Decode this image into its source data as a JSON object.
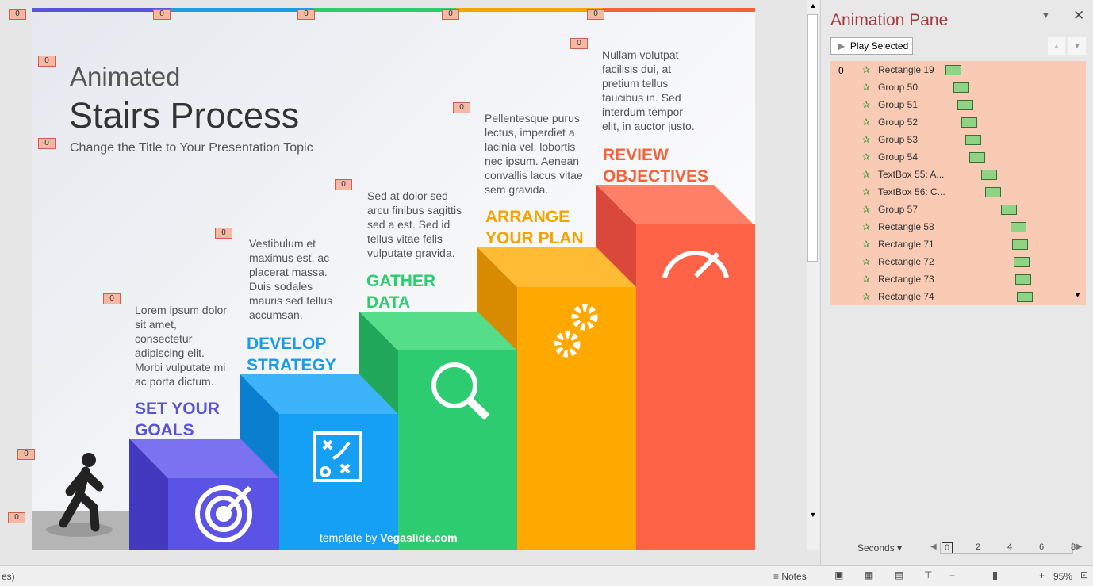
{
  "slide": {
    "title_line1": "Animated",
    "title_line2": "Stairs Process",
    "subtitle": "Change the Title to Your Presentation Topic",
    "steps": [
      {
        "heading1": "SET YOUR",
        "heading2": "GOALS",
        "text": [
          "Lorem ipsum dolor",
          "sit amet,",
          "consectetur",
          "adipiscing elit.",
          "Morbi vulputate mi",
          "ac porta dictum."
        ],
        "color": "#5a52d8",
        "icon": "target-icon"
      },
      {
        "heading1": "DEVELOP",
        "heading2": "STRATEGY",
        "text": [
          "Vestibulum et",
          "maximus est, ac",
          "placerat massa.",
          "Duis sodales",
          "mauris sed tellus",
          "accumsan."
        ],
        "color": "#1a9de6",
        "icon": "strategy-board-icon"
      },
      {
        "heading1": "GATHER",
        "heading2": "DATA",
        "text": [
          "Sed at dolor sed",
          "arcu finibus sagittis",
          "sed a est. Sed id",
          "tellus vitae felis",
          "vulputate gravida."
        ],
        "color": "#2ecc71",
        "icon": "magnifier-icon"
      },
      {
        "heading1": "ARRANGE",
        "heading2": "YOUR PLAN",
        "text": [
          "Pellentesque purus",
          "lectus, imperdiet a",
          "lacinia vel, lobortis",
          "nec ipsum. Aenean",
          "convallis lacus vitae",
          "sem gravida."
        ],
        "color": "#f5a300",
        "icon": "gears-icon"
      },
      {
        "heading1": "REVIEW",
        "heading2": "OBJECTIVES",
        "text": [
          "Nullam volutpat",
          "facilisis dui, at",
          "pretium tellus",
          "faucibus in. Sed",
          "interdum tempor",
          "elit, in auctor justo."
        ],
        "color": "#f4623a",
        "icon": "speedometer-icon"
      }
    ],
    "credit_prefix": "template by ",
    "credit_brand": "Vegaslide.com",
    "animation_tag": "0"
  },
  "pane": {
    "title": "Animation Pane",
    "play_selected": "Play Selected",
    "start_index": "0",
    "items": [
      "Rectangle 19",
      "Group 50",
      "Group 51",
      "Group 52",
      "Group 53",
      "Group 54",
      "TextBox 55: A...",
      "TextBox 56: C...",
      "Group 57",
      "Rectangle 58",
      "Rectangle 71",
      "Rectangle 72",
      "Rectangle 73",
      "Rectangle 74"
    ],
    "timeline_unit": "Seconds",
    "timeline_ticks": [
      "0",
      "2",
      "4",
      "6",
      "8"
    ]
  },
  "status": {
    "left_text": "es)",
    "notes": "Notes",
    "zoom": "95%"
  }
}
